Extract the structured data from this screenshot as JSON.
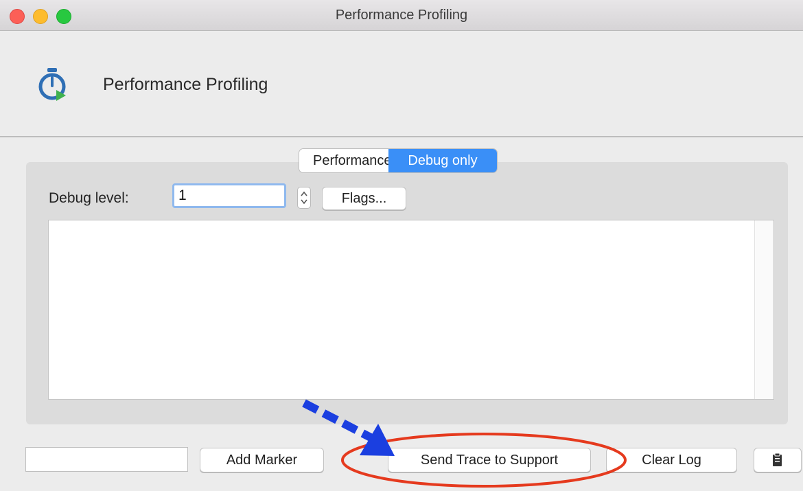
{
  "window": {
    "title": "Performance Profiling"
  },
  "header": {
    "title": "Performance Profiling",
    "icon": "stopwatch-play-icon"
  },
  "tabs": [
    {
      "label": "Performance",
      "selected": false
    },
    {
      "label": "Debug only",
      "selected": true
    }
  ],
  "debug": {
    "label": "Debug level:",
    "value": "1",
    "stepper_glyph": "⌃⌄",
    "flags_label": "Flags..."
  },
  "log": {
    "content": ""
  },
  "footer": {
    "marker_value": "",
    "add_marker_label": "Add Marker",
    "send_trace_label": "Send Trace to Support",
    "clear_log_label": "Clear Log",
    "copy_icon": "clipboard-copy-icon"
  },
  "annotation": {
    "arrow_color": "#1b3fe0",
    "ellipse_color": "#e53a1e"
  },
  "colors": {
    "accent": "#3a8ff7",
    "traffic_close": "#fc5f57",
    "traffic_min": "#fdbc2e",
    "traffic_max": "#28c840"
  }
}
